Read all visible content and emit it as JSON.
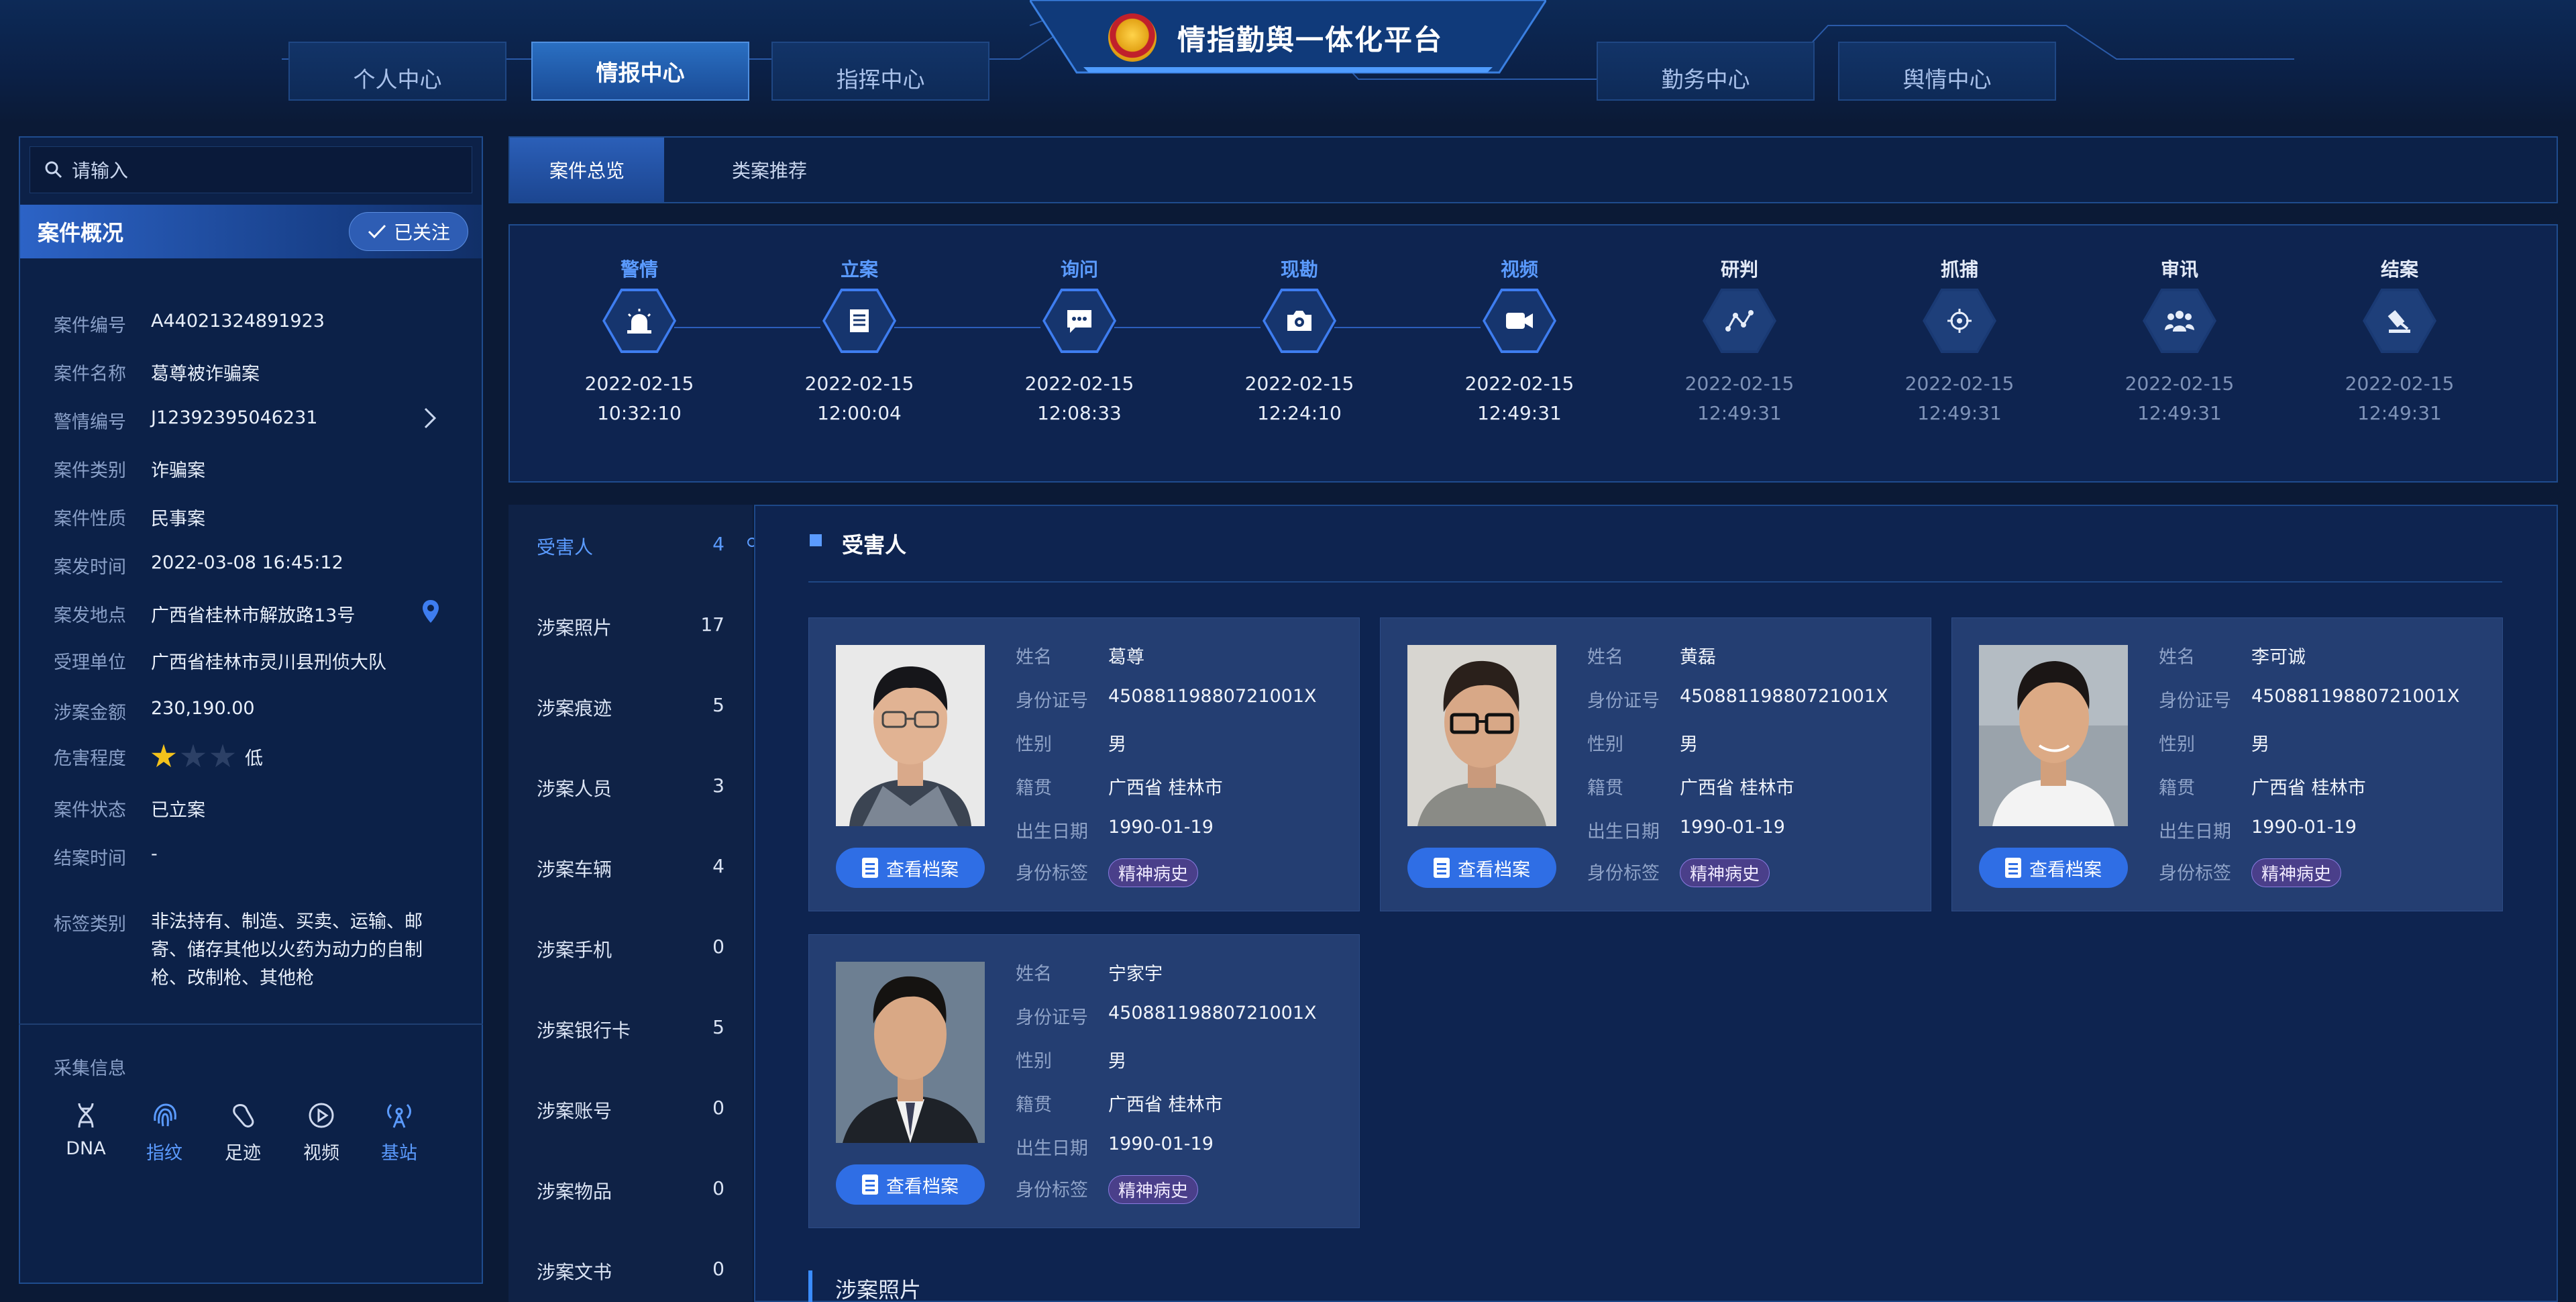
{
  "header": {
    "title": "情指勤舆一体化平台",
    "tabs_left": [
      "个人中心",
      "情报中心",
      "指挥中心"
    ],
    "tabs_right": [
      "勤务中心",
      "舆情中心"
    ],
    "active_tab": "情报中心"
  },
  "search": {
    "placeholder": "请输入"
  },
  "case": {
    "title": "案件概况",
    "follow_label": "已关注",
    "fields": [
      {
        "k": "案件编号",
        "v": "A44021324891923"
      },
      {
        "k": "案件名称",
        "v": "葛尊被诈骗案"
      },
      {
        "k": "警情编号",
        "v": "J12392395046231"
      },
      {
        "k": "案件类别",
        "v": "诈骗案"
      },
      {
        "k": "案件性质",
        "v": "民事案"
      },
      {
        "k": "案发时间",
        "v": "2022-03-08 16:45:12"
      },
      {
        "k": "案发地点",
        "v": "广西省桂林市解放路13号"
      },
      {
        "k": "受理单位",
        "v": "广西省桂林市灵川县刑侦大队"
      },
      {
        "k": "涉案金额",
        "v": "230,190.00"
      },
      {
        "k": "危害程度",
        "v": "低",
        "stars": 1,
        "stars_total": 3
      },
      {
        "k": "案件状态",
        "v": "已立案"
      },
      {
        "k": "结案时间",
        "v": "-"
      },
      {
        "k": "标签类别",
        "v1": "非法持有、制造、买卖、运输、邮",
        "v2": "寄、储存其他以火药为动力的自制",
        "v3": "枪、改制枪、其他枪"
      }
    ],
    "collect_title": "采集信息",
    "collect_items": [
      {
        "label": "DNA",
        "icon": "dna-icon",
        "highlight": false
      },
      {
        "label": "指纹",
        "icon": "fingerprint-icon",
        "highlight": true
      },
      {
        "label": "足迹",
        "icon": "footprint-icon",
        "highlight": false
      },
      {
        "label": "视频",
        "icon": "video-play-icon",
        "highlight": false
      },
      {
        "label": "基站",
        "icon": "base-station-icon",
        "highlight": true
      }
    ]
  },
  "subtabs": [
    "案件总览",
    "类案推荐"
  ],
  "timeline": [
    {
      "label": "警情",
      "date": "2022-02-15",
      "time": "10:32:10",
      "done": true,
      "icon": "alarm-icon"
    },
    {
      "label": "立案",
      "date": "2022-02-15",
      "time": "12:00:04",
      "done": true,
      "icon": "file-icon"
    },
    {
      "label": "询问",
      "date": "2022-02-15",
      "time": "12:08:33",
      "done": true,
      "icon": "chat-icon"
    },
    {
      "label": "现勘",
      "date": "2022-02-15",
      "time": "12:24:10",
      "done": true,
      "icon": "camera-icon"
    },
    {
      "label": "视频",
      "date": "2022-02-15",
      "time": "12:49:31",
      "done": true,
      "icon": "video-icon"
    },
    {
      "label": "研判",
      "date": "2022-02-15",
      "time": "12:49:31",
      "done": false,
      "icon": "analysis-icon"
    },
    {
      "label": "抓捕",
      "date": "2022-02-15",
      "time": "12:49:31",
      "done": false,
      "icon": "target-icon"
    },
    {
      "label": "审讯",
      "date": "2022-02-15",
      "time": "12:49:31",
      "done": false,
      "icon": "people-icon"
    },
    {
      "label": "结案",
      "date": "2022-02-15",
      "time": "12:49:31",
      "done": false,
      "icon": "gavel-icon"
    }
  ],
  "menu": [
    {
      "label": "受害人",
      "count": "4",
      "active": true
    },
    {
      "label": "涉案照片",
      "count": "17"
    },
    {
      "label": "涉案痕迹",
      "count": "5"
    },
    {
      "label": "涉案人员",
      "count": "3"
    },
    {
      "label": "涉案车辆",
      "count": "4"
    },
    {
      "label": "涉案手机",
      "count": "0"
    },
    {
      "label": "涉案银行卡",
      "count": "5"
    },
    {
      "label": "涉案账号",
      "count": "0"
    },
    {
      "label": "涉案物品",
      "count": "0"
    },
    {
      "label": "涉案文书",
      "count": "0"
    }
  ],
  "victims_section": {
    "title": "受害人",
    "field_labels": {
      "name": "姓名",
      "id": "身份证号",
      "gender": "性别",
      "origin": "籍贯",
      "birth": "出生日期",
      "tag": "身份标签"
    },
    "button_label": "查看档案",
    "people": [
      {
        "name": "葛尊",
        "id": "45088119880721001X",
        "gender": "男",
        "origin": "广西省 桂林市",
        "birth": "1990-01-19",
        "tag": "精神病史"
      },
      {
        "name": "黄磊",
        "id": "45088119880721001X",
        "gender": "男",
        "origin": "广西省 桂林市",
        "birth": "1990-01-19",
        "tag": "精神病史"
      },
      {
        "name": "李可诚",
        "id": "45088119880721001X",
        "gender": "男",
        "origin": "广西省 桂林市",
        "birth": "1990-01-19",
        "tag": "精神病史"
      },
      {
        "name": "宁家宇",
        "id": "45088119880721001X",
        "gender": "男",
        "origin": "广西省 桂林市",
        "birth": "1990-01-19",
        "tag": "精神病史"
      }
    ]
  },
  "next_section_title": "涉案照片",
  "colors": {
    "accent": "#3e7df0",
    "active_text": "#5b9bff",
    "tag": "#4a3f8a",
    "star": "#f4c21b"
  }
}
